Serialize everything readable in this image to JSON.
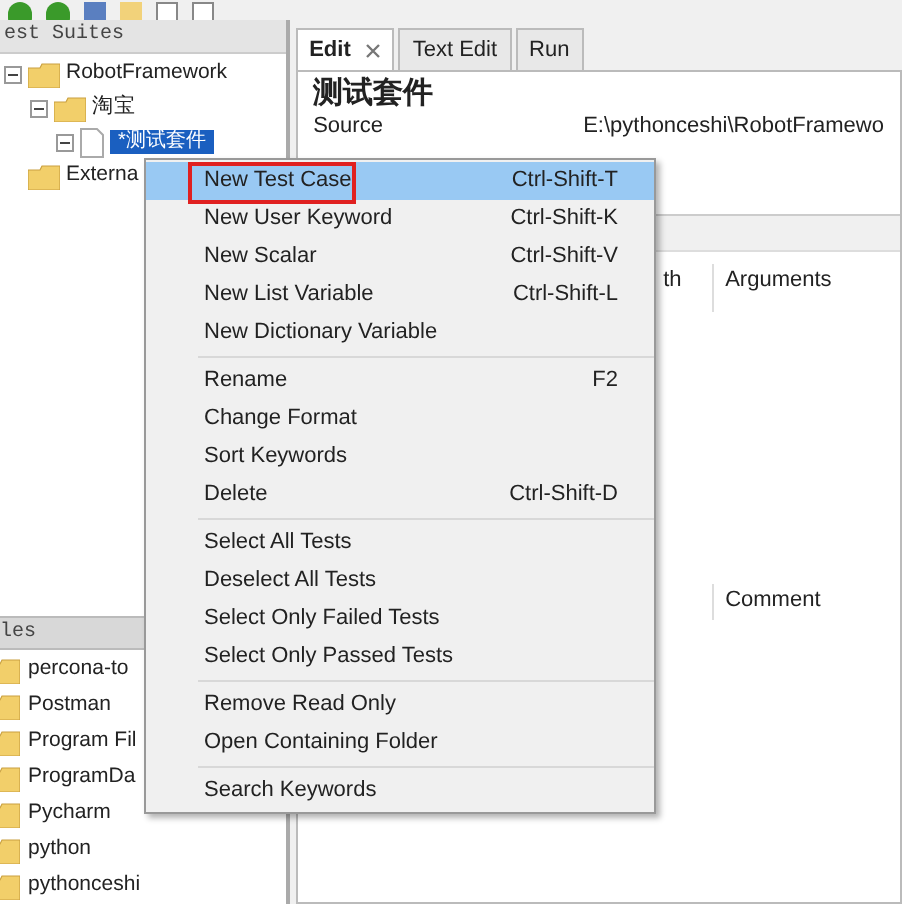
{
  "suites_panel": {
    "header": "est Suites",
    "tree": [
      {
        "label": "RobotFramework",
        "kind": "folder",
        "expanded": true,
        "selected": false,
        "children": [
          {
            "label": "淘宝",
            "kind": "folder",
            "expanded": true,
            "selected": false,
            "children": [
              {
                "label": "*测试套件",
                "kind": "file",
                "expanded": true,
                "selected": true
              }
            ]
          }
        ]
      },
      {
        "label": "Externa",
        "kind": "folder",
        "selected": false
      }
    ]
  },
  "files_panel": {
    "header": "les",
    "items": [
      "percona-to",
      "Postman",
      "Program Fil",
      "ProgramDa",
      "Pycharm",
      "python",
      "pythonceshi"
    ]
  },
  "editor": {
    "tabs": [
      {
        "label": "Edit",
        "selected": true,
        "closable": true
      },
      {
        "label": "Text Edit",
        "selected": false,
        "closable": false
      },
      {
        "label": "Run",
        "selected": false,
        "closable": false
      }
    ],
    "title": "测试套件",
    "source_label": "Source",
    "source_value": "E:\\pythonceshi\\RobotFramewo",
    "columns": [
      "th",
      "Arguments"
    ],
    "comment_label": "Comment"
  },
  "context_menu": {
    "groups": [
      [
        {
          "label": "New Test Case",
          "shortcut": "Ctrl-Shift-T",
          "selected": true,
          "marked": true
        },
        {
          "label": "New User Keyword",
          "shortcut": "Ctrl-Shift-K",
          "selected": false,
          "marked": false
        },
        {
          "label": "New Scalar",
          "shortcut": "Ctrl-Shift-V",
          "selected": false,
          "marked": false
        },
        {
          "label": "New List Variable",
          "shortcut": "Ctrl-Shift-L",
          "selected": false,
          "marked": false
        },
        {
          "label": "New Dictionary Variable",
          "selected": false,
          "marked": false
        }
      ],
      [
        {
          "label": "Rename",
          "shortcut": "F2",
          "selected": false,
          "marked": false
        },
        {
          "label": "Change Format",
          "selected": false,
          "marked": false
        },
        {
          "label": "Sort Keywords",
          "selected": false,
          "marked": false
        },
        {
          "label": "Delete",
          "shortcut": "Ctrl-Shift-D",
          "selected": false,
          "marked": false
        }
      ],
      [
        {
          "label": "Select All Tests",
          "selected": false,
          "marked": false
        },
        {
          "label": "Deselect All Tests",
          "selected": false,
          "marked": false
        },
        {
          "label": "Select Only Failed Tests",
          "selected": false,
          "marked": false
        },
        {
          "label": "Select Only Passed Tests",
          "selected": false,
          "marked": false
        }
      ],
      [
        {
          "label": "Remove Read Only",
          "selected": false,
          "marked": false
        },
        {
          "label": "Open Containing Folder",
          "selected": false,
          "marked": false
        }
      ],
      [
        {
          "label": "Search Keywords",
          "selected": false,
          "marked": false
        }
      ]
    ]
  }
}
